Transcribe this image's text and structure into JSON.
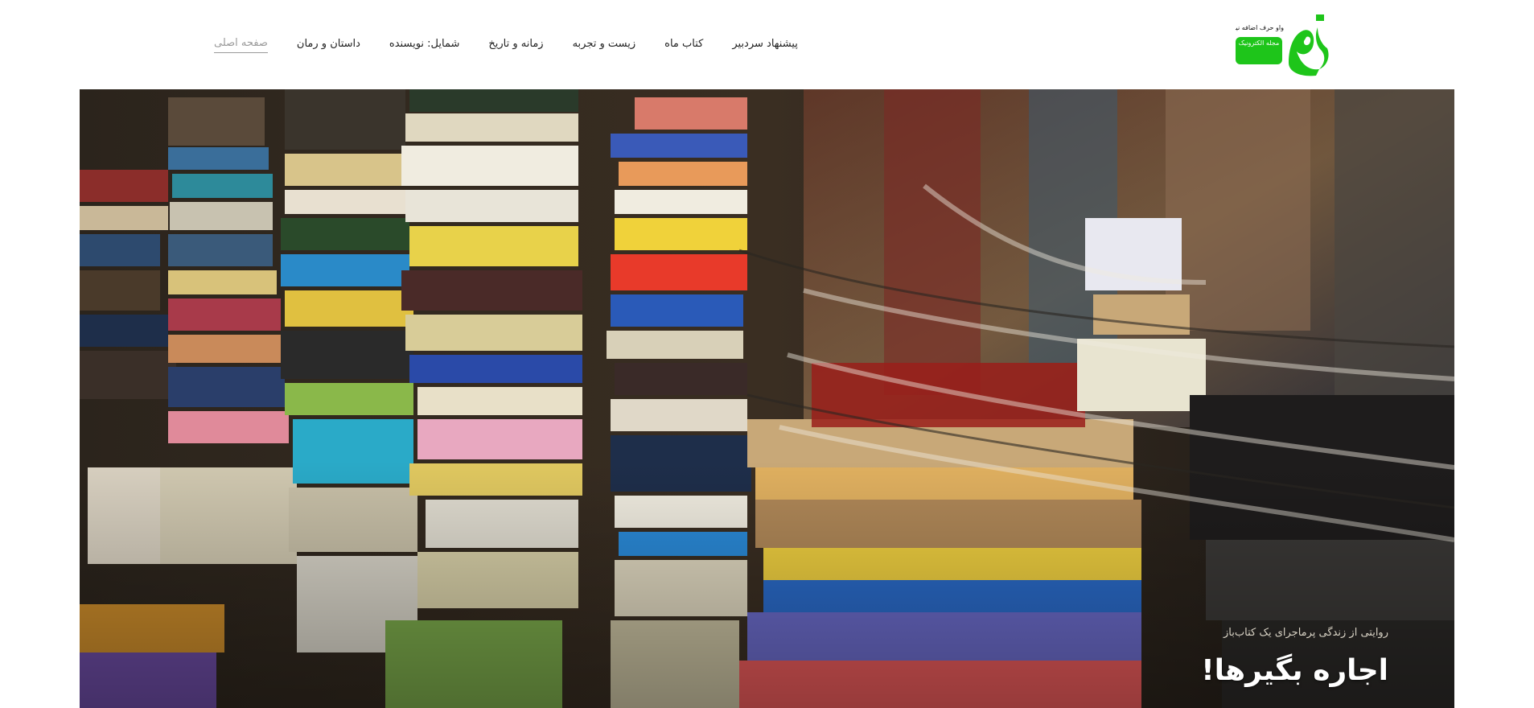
{
  "brand": {
    "logo_text": "واو",
    "tagline": "واو حرف اضافه نیست!",
    "subtitle": "مجله الکترونیک",
    "green": "#1ec51a"
  },
  "nav": {
    "items": [
      {
        "label": "صفحه اصلی",
        "active": true
      },
      {
        "label": "داستان و رمان",
        "active": false
      },
      {
        "label": "شمایل: نویسنده",
        "active": false
      },
      {
        "label": "زمانه و تاریخ",
        "active": false
      },
      {
        "label": "زیست و تجربه",
        "active": false
      },
      {
        "label": "کتاب ماه",
        "active": false
      },
      {
        "label": "پیشنهاد سردبیر",
        "active": false
      }
    ]
  },
  "hero": {
    "image": "stacks-of-old-books-photo",
    "kicker": "روایتی از زندگی پرماجرای یک کتاب‌باز",
    "title": "اجاره بگیرها!"
  }
}
